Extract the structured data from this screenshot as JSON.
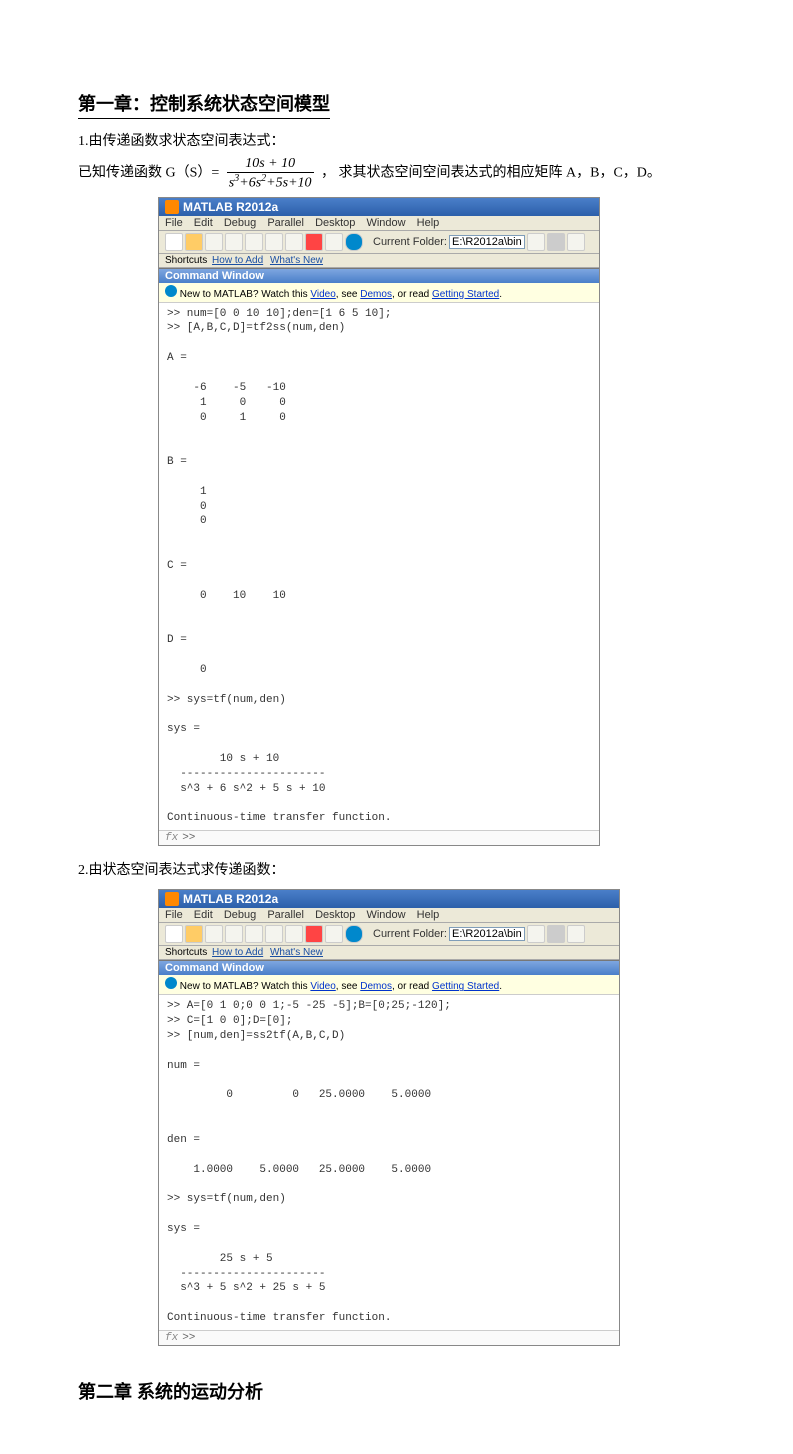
{
  "chapter1_title": "第一章：控制系统状态空间模型",
  "item1_label": "1.由传递函数求状态空间表达式：",
  "item1_prefix": "已知传递函数 G（S）=",
  "frac_num": "10s + 10",
  "frac_den_html": "s³ + 6s² + 5s + 10",
  "item1_suffix": "， 求其状态空间空间表达式的相应矩阵 A，B，C，D。",
  "item2_label": "2.由状态空间表达式求传递函数：",
  "chapter2_title": "第二章 系统的运动分析",
  "matlab1": {
    "title": "MATLAB   R2012a",
    "menu": {
      "file": "File",
      "edit": "Edit",
      "debug": "Debug",
      "parallel": "Parallel",
      "desktop": "Desktop",
      "window": "Window",
      "help": "Help"
    },
    "folder_label": "Current Folder:",
    "folder_value": "E:\\R2012a\\bin",
    "shortcuts_prefix": "Shortcuts ",
    "shortcuts_howto": "How to Add",
    "shortcuts_whatsnew": "What's New",
    "cw_title": "Command Window",
    "newto_prefix": "New to MATLAB? Watch this ",
    "newto_video": "Video",
    "newto_mid1": ", see ",
    "newto_demos": "Demos",
    "newto_mid2": ", or read ",
    "newto_started": "Getting Started",
    "body": ">> num=[0 0 10 10];den=[1 6 5 10];\n>> [A,B,C,D]=tf2ss(num,den)\n\nA =\n\n    -6    -5   -10\n     1     0     0\n     0     1     0\n\n\nB =\n\n     1\n     0\n     0\n\n\nC =\n\n     0    10    10\n\n\nD =\n\n     0\n\n>> sys=tf(num,den)\n\nsys =\n\n        10 s + 10\n  ----------------------\n  s^3 + 6 s^2 + 5 s + 10\n\nContinuous-time transfer function.\n",
    "fx_prompt": ">>"
  },
  "matlab2": {
    "title": "MATLAB   R2012a",
    "menu": {
      "file": "File",
      "edit": "Edit",
      "debug": "Debug",
      "parallel": "Parallel",
      "desktop": "Desktop",
      "window": "Window",
      "help": "Help"
    },
    "folder_label": "Current Folder:",
    "folder_value": "E:\\R2012a\\bin",
    "shortcuts_prefix": "Shortcuts ",
    "shortcuts_howto": "How to Add",
    "shortcuts_whatsnew": "What's New",
    "cw_title": "Command Window",
    "newto_prefix": "New to MATLAB? Watch this ",
    "newto_video": "Video",
    "newto_mid1": ", see ",
    "newto_demos": "Demos",
    "newto_mid2": ", or read ",
    "newto_started": "Getting Started",
    "body": ">> A=[0 1 0;0 0 1;-5 -25 -5];B=[0;25;-120];\n>> C=[1 0 0];D=[0];\n>> [num,den]=ss2tf(A,B,C,D)\n\nnum =\n\n         0         0   25.0000    5.0000\n\n\nden =\n\n    1.0000    5.0000   25.0000    5.0000\n\n>> sys=tf(num,den)\n\nsys =\n\n        25 s + 5\n  ----------------------\n  s^3 + 5 s^2 + 25 s + 5\n\nContinuous-time transfer function.\n",
    "fx_prompt": ">>"
  }
}
